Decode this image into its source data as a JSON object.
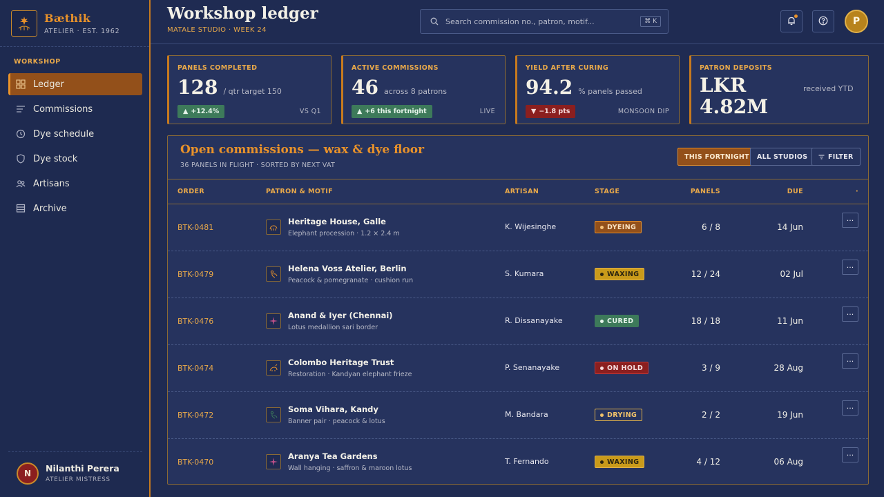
{
  "brand": {
    "name": "Bæthik",
    "sub": "ATELIER · EST. 1962"
  },
  "nav": {
    "section": "WORKSHOP",
    "items": [
      {
        "label": "Ledger",
        "icon": "grid-icon",
        "active": true
      },
      {
        "label": "Commissions",
        "icon": "list-icon"
      },
      {
        "label": "Dye schedule",
        "icon": "clock-icon"
      },
      {
        "label": "Dye stock",
        "icon": "shield-icon"
      },
      {
        "label": "Artisans",
        "icon": "users-icon"
      },
      {
        "label": "Archive",
        "icon": "archive-icon"
      }
    ]
  },
  "user": {
    "initial": "N",
    "name": "Nilanthi Perera",
    "role": "ATELIER MISTRESS"
  },
  "header": {
    "title": "Workshop ledger",
    "sub": "MATALE STUDIO · WEEK 24",
    "search_placeholder": "Search commission no., patron, motif...",
    "shortcut": "⌘ K",
    "avatar_initial": "P"
  },
  "kpis": [
    {
      "label": "PANELS COMPLETED",
      "value": "128",
      "note": "/ qtr target 150",
      "chip": "+12.4%",
      "chip_dir": "up",
      "tag": "VS Q1"
    },
    {
      "label": "ACTIVE COMMISSIONS",
      "value": "46",
      "note": "across 8 patrons",
      "chip": "+6 this fortnight",
      "chip_dir": "up",
      "tag": "LIVE"
    },
    {
      "label": "YIELD AFTER CURING",
      "value": "94.2",
      "note": "% panels passed",
      "chip": "−1.8 pts",
      "chip_dir": "down",
      "tag": "MONSOON DIP"
    },
    {
      "label": "PATRON DEPOSITS",
      "value": "LKR 4.82M",
      "note": "received YTD"
    }
  ],
  "panel": {
    "title": "Open commissions — wax & dye floor",
    "sub": "36 PANELS IN FLIGHT · SORTED BY NEXT VAT",
    "filters": {
      "fortnight": "THIS FORTNIGHT",
      "studios": "ALL STUDIOS",
      "filter": "FILTER"
    },
    "columns": {
      "order": "ORDER",
      "patron": "PATRON & MOTIF",
      "artisan": "ARTISAN",
      "stage": "STAGE",
      "panels": "PANELS",
      "due": "DUE"
    },
    "rows": [
      {
        "order": "BTK-0481",
        "patron": "Heritage House, Galle",
        "motif": "Elephant procession · 1.2 × 2.4 m",
        "artisan": "K. Wijesinghe",
        "stage": "DYEING",
        "panels": "6 / 8",
        "due": "14 Jun"
      },
      {
        "order": "BTK-0479",
        "patron": "Helena Voss Atelier, Berlin",
        "motif": "Peacock & pomegranate · cushion run",
        "artisan": "S. Kumara",
        "stage": "WAXING",
        "panels": "12 / 24",
        "due": "02 Jul"
      },
      {
        "order": "BTK-0476",
        "patron": "Anand & Iyer (Chennai)",
        "motif": "Lotus medallion sari border",
        "artisan": "R. Dissanayake",
        "stage": "CURED",
        "panels": "18 / 18",
        "due": "11 Jun"
      },
      {
        "order": "BTK-0474",
        "patron": "Colombo Heritage Trust",
        "motif": "Restoration · Kandyan elephant frieze",
        "artisan": "P. Senanayake",
        "stage": "ON HOLD",
        "panels": "3 / 9",
        "due": "28 Aug"
      },
      {
        "order": "BTK-0472",
        "patron": "Soma Vihara, Kandy",
        "motif": "Banner pair · peacock & lotus",
        "artisan": "M. Bandara",
        "stage": "DRYING",
        "panels": "2 / 2",
        "due": "19 Jun"
      },
      {
        "order": "BTK-0470",
        "patron": "Aranya Tea Gardens",
        "motif": "Wall hanging · saffron & maroon lotus",
        "artisan": "T. Fernando",
        "stage": "WAXING",
        "panels": "4 / 12",
        "due": "06 Aug"
      }
    ]
  },
  "colors": {
    "accent": "#e9922a",
    "bg": "#1f2b52",
    "card": "#26335e"
  }
}
